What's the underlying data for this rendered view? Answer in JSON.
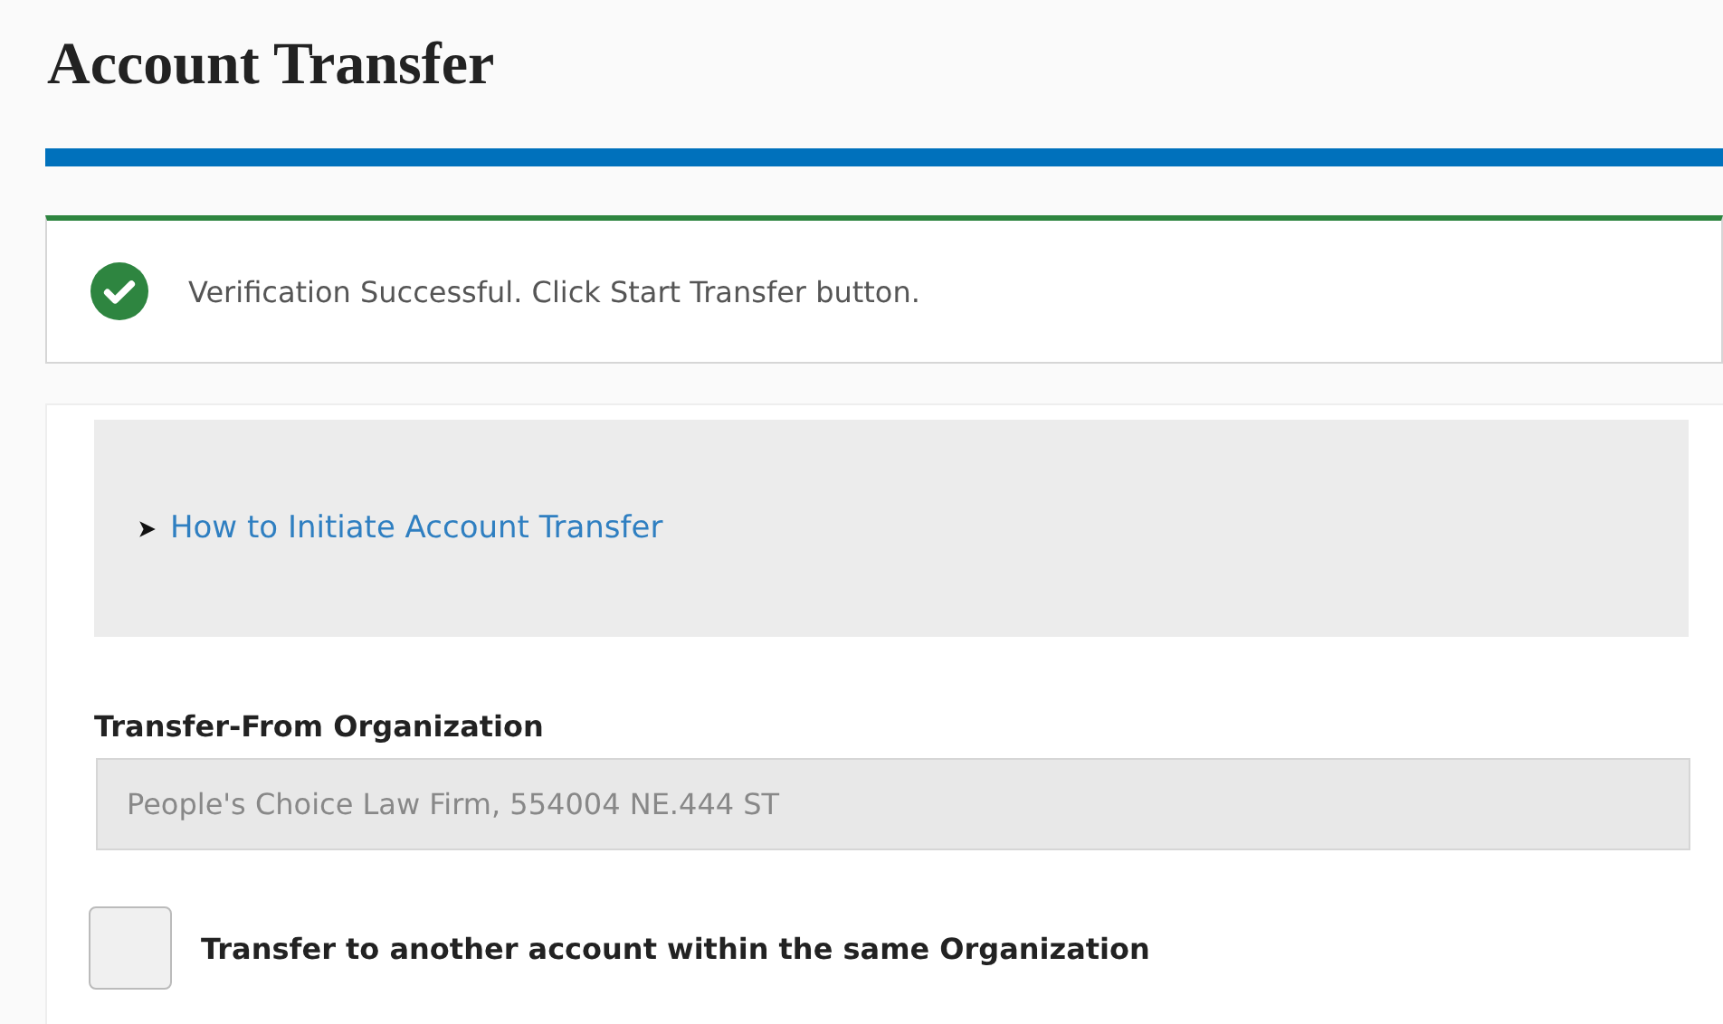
{
  "page": {
    "title": "Account Transfer"
  },
  "alert": {
    "kind": "success",
    "message": "Verification Successful. Click Start Transfer button."
  },
  "help": {
    "label": "How to Initiate Account Transfer",
    "expanded": false
  },
  "from_org": {
    "label": "Transfer-From Organization",
    "value": "People's Choice Law Firm, 554004 NE.444 ST",
    "disabled": true
  },
  "same_org": {
    "label": "Transfer to another account within the same Organization",
    "checked": false
  }
}
